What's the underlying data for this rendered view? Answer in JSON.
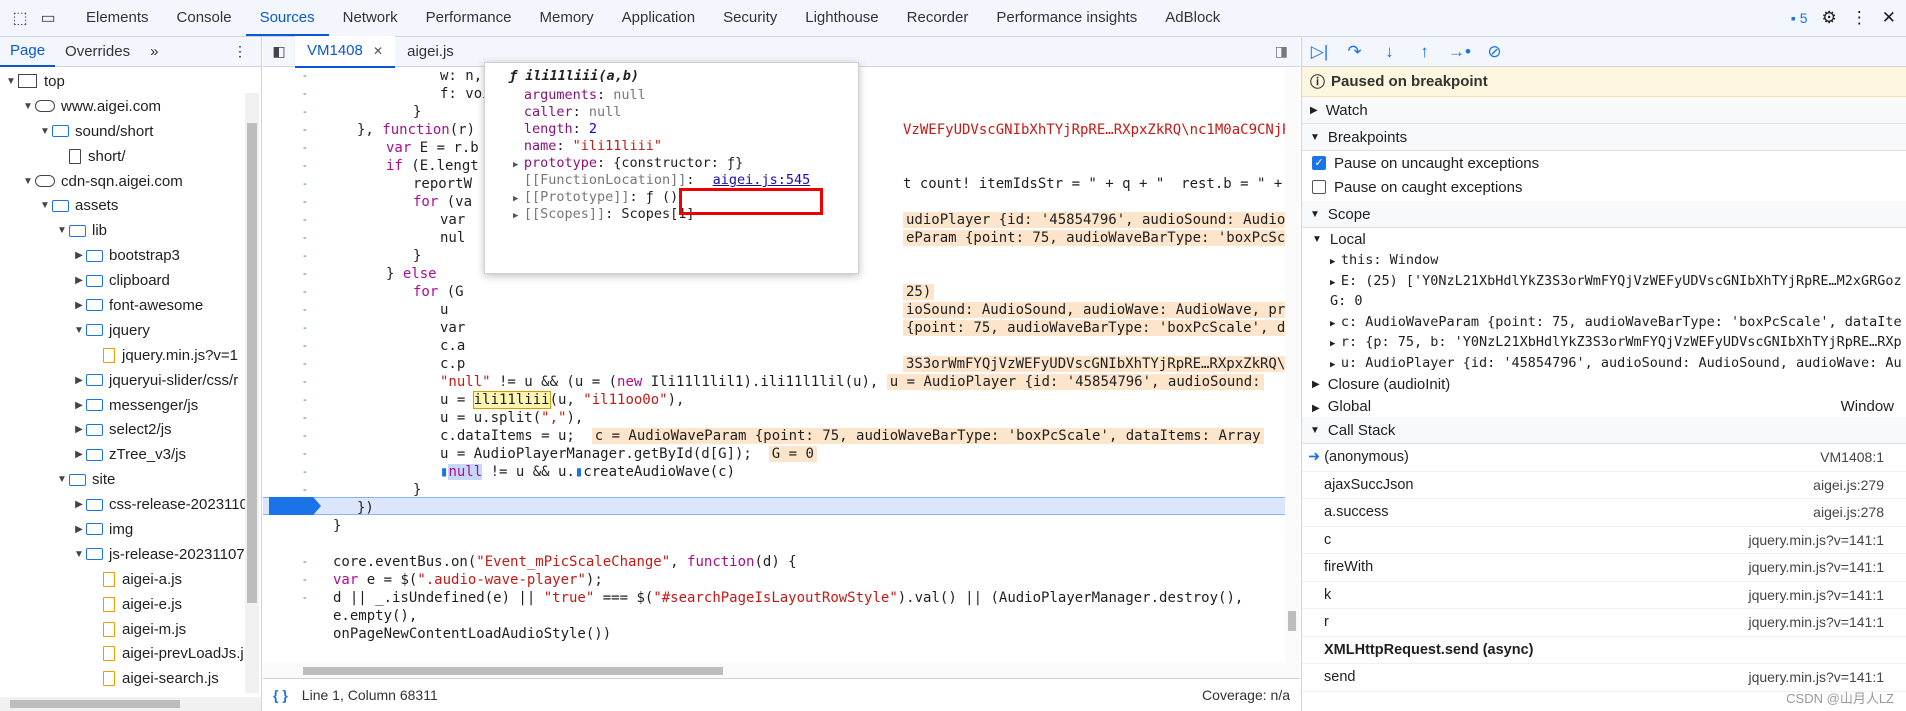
{
  "topbar": {
    "tabs": [
      "Elements",
      "Console",
      "Sources",
      "Network",
      "Performance",
      "Memory",
      "Application",
      "Security",
      "Lighthouse",
      "Recorder",
      "Performance insights",
      "AdBlock"
    ],
    "active_tab": "Sources",
    "issues_count": "5"
  },
  "left": {
    "subtabs": [
      "Page",
      "Overrides"
    ],
    "tree": [
      {
        "label": "top",
        "type": "frame",
        "depth": 0,
        "open": true
      },
      {
        "label": "www.aigei.com",
        "type": "cloud",
        "depth": 1,
        "open": true
      },
      {
        "label": "sound/short",
        "type": "folder",
        "depth": 2,
        "open": true
      },
      {
        "label": "short/",
        "type": "file",
        "depth": 3
      },
      {
        "label": "cdn-sqn.aigei.com",
        "type": "cloud",
        "depth": 1,
        "open": true
      },
      {
        "label": "assets",
        "type": "folder",
        "depth": 2,
        "open": true
      },
      {
        "label": "lib",
        "type": "folder",
        "depth": 3,
        "open": true
      },
      {
        "label": "bootstrap3",
        "type": "folder",
        "depth": 4,
        "open": false
      },
      {
        "label": "clipboard",
        "type": "folder",
        "depth": 4,
        "open": false
      },
      {
        "label": "font-awesome",
        "type": "folder",
        "depth": 4,
        "open": false
      },
      {
        "label": "jquery",
        "type": "folder",
        "depth": 4,
        "open": true
      },
      {
        "label": "jquery.min.js?v=1",
        "type": "jsfile",
        "depth": 5
      },
      {
        "label": "jqueryui-slider/css/r",
        "type": "folder",
        "depth": 4,
        "open": false
      },
      {
        "label": "messenger/js",
        "type": "folder",
        "depth": 4,
        "open": false
      },
      {
        "label": "select2/js",
        "type": "folder",
        "depth": 4,
        "open": false
      },
      {
        "label": "zTree_v3/js",
        "type": "folder",
        "depth": 4,
        "open": false
      },
      {
        "label": "site",
        "type": "folder",
        "depth": 3,
        "open": true
      },
      {
        "label": "css-release-2023110",
        "type": "folder",
        "depth": 4,
        "open": false
      },
      {
        "label": "img",
        "type": "folder",
        "depth": 4,
        "open": false
      },
      {
        "label": "js-release-20231107",
        "type": "folder",
        "depth": 4,
        "open": true
      },
      {
        "label": "aigei-a.js",
        "type": "jsfile",
        "depth": 5
      },
      {
        "label": "aigei-e.js",
        "type": "jsfile",
        "depth": 5
      },
      {
        "label": "aigei-m.js",
        "type": "jsfile",
        "depth": 5
      },
      {
        "label": "aigei-prevLoadJs.j",
        "type": "jsfile",
        "depth": 5
      },
      {
        "label": "aigei-search.js",
        "type": "jsfile",
        "depth": 5
      }
    ]
  },
  "editor": {
    "tabs": [
      "VM1408",
      "aigei.js"
    ],
    "active_tab": "VM1408",
    "status": "Line 1, Column 68311",
    "coverage": "Coverage: n/a"
  },
  "popover": {
    "title": "ƒ ili11liii(a,b)",
    "props": [
      {
        "k": "arguments",
        "v": "null"
      },
      {
        "k": "caller",
        "v": "null"
      },
      {
        "k": "length",
        "v": "2"
      },
      {
        "k": "name",
        "v": "\"ili11liii\""
      },
      {
        "k": "prototype",
        "v": "{constructor: ƒ}"
      },
      {
        "k": "[[FunctionLocation]]",
        "v": "aigei.js:545"
      },
      {
        "k": "[[Prototype]]",
        "v": "ƒ ()"
      },
      {
        "k": "[[Scopes]]",
        "v": "Scopes[1]"
      }
    ]
  },
  "debugger": {
    "paused_label": "Paused on breakpoint",
    "watch": "Watch",
    "breakpoints": "Breakpoints",
    "pause_uncaught": "Pause on uncaught exceptions",
    "pause_caught": "Pause on caught exceptions",
    "scope": "Scope",
    "local": "Local",
    "scope_rows": [
      "this: Window",
      "E: (25) ['Y0NzL21XbHdlYkZ3S3orWmFYQjVzWEFyUDVscGNIbXhTYjRpRE…M2xGRGoz",
      "G: 0",
      "c: AudioWaveParam {point: 75, audioWaveBarType: 'boxPcScale', dataIte",
      "r: {p: 75, b: 'Y0NzL21XbHdlYkZ3S3orWmFYQjVzWEFyUDVscGNIbXhTYjRpRE…RXp",
      "u: AudioPlayer {id: '45854796', audioSound: AudioSound, audioWave: Au"
    ],
    "closure": "Closure (audioInit)",
    "global": "Global",
    "global_val": "Window",
    "call_stack": "Call Stack",
    "frames": [
      {
        "name": "(anonymous)",
        "loc": "VM1408:1",
        "current": true
      },
      {
        "name": "ajaxSuccJson",
        "loc": "aigei.js:279"
      },
      {
        "name": "a.success",
        "loc": "aigei.js:278"
      },
      {
        "name": "c",
        "loc": "jquery.min.js?v=141:1"
      },
      {
        "name": "fireWith",
        "loc": "jquery.min.js?v=141:1"
      },
      {
        "name": "k",
        "loc": "jquery.min.js?v=141:1"
      },
      {
        "name": "r",
        "loc": "jquery.min.js?v=141:1"
      }
    ],
    "async_label": "XMLHttpRequest.send (async)",
    "last_frame": {
      "name": "send",
      "loc": "jquery.min.js?v=141:1"
    },
    "watermark": "CSDN @山月人LZ"
  }
}
